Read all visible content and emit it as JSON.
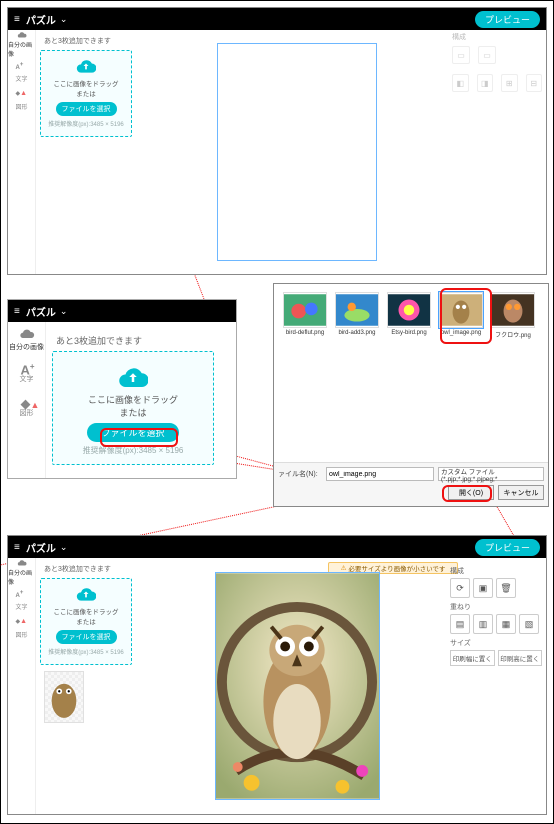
{
  "app": {
    "title": "パズル"
  },
  "topbar": {
    "preview": "プレビュー"
  },
  "rail": {
    "items": [
      {
        "icon": "cloud-upload-icon",
        "label": "自分の画像"
      },
      {
        "icon": "text-icon",
        "label": "文字"
      },
      {
        "icon": "shapes-icon",
        "label": "図形"
      }
    ]
  },
  "upload": {
    "limit": "あと3枚追加できます",
    "drag_here": "ここに画像をドラッグ",
    "or": "または",
    "select": "ファイルを選択",
    "rec_size": "推奨解像度(px):3485 × 5196"
  },
  "inspector_top": {
    "title": "構成"
  },
  "file_dialog": {
    "files": [
      {
        "name": "bird-deflut.png"
      },
      {
        "name": "bird-add3.png"
      },
      {
        "name": "Etsy-bird.png"
      },
      {
        "name": "owl_image.png",
        "selected": true
      },
      {
        "name": "フクロウ.png"
      }
    ],
    "filename_label": "ァイル名(N):",
    "filename_value": "owl_image.png",
    "type_filter": "カスタム ファイル (*.pjp;*.jpg;*.pjpeg;*",
    "open": "開く(O)",
    "cancel": "キャンセル"
  },
  "banner": {
    "text": "必要サイズより画像が小さいです"
  },
  "inspectorD": {
    "compose": "構成",
    "compose_items": [
      "置き換え",
      "背",
      "削除"
    ],
    "category": "重ねり",
    "size": "サイズ",
    "size_btns": [
      "印刷幅に置く",
      "印刷高に置く"
    ]
  }
}
